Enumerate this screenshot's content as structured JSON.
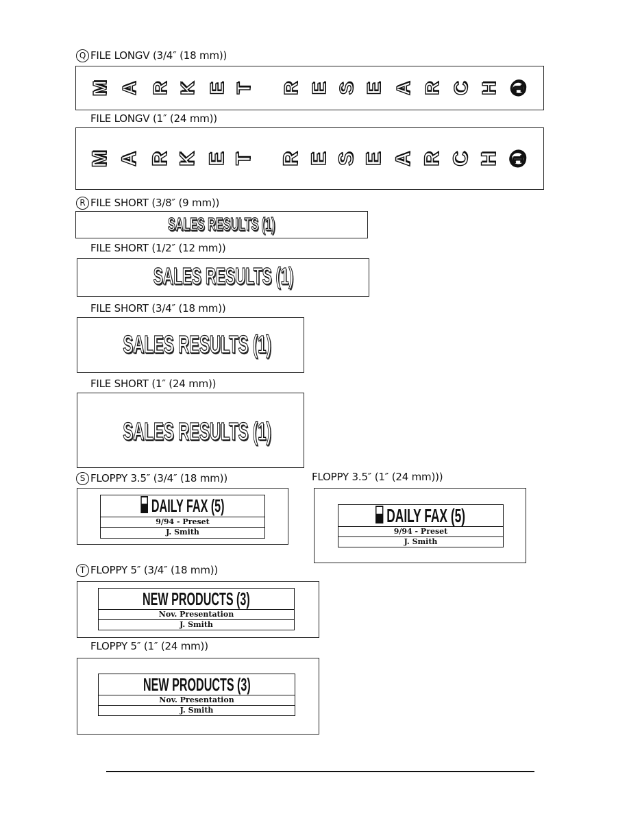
{
  "sections": {
    "q": {
      "marker": "Q",
      "items": [
        {
          "heading": "FILE LONGV (3/4″ (18 mm))",
          "letters": [
            "M",
            "A",
            "R",
            "K",
            "E",
            "T",
            "R",
            "E",
            "S",
            "E",
            "A",
            "R",
            "C",
            "H",
            "①"
          ]
        },
        {
          "heading": "FILE LONGV (1″ (24 mm))",
          "letters": [
            "M",
            "A",
            "R",
            "K",
            "E",
            "T",
            "R",
            "E",
            "S",
            "E",
            "A",
            "R",
            "C",
            "H",
            "①"
          ]
        }
      ]
    },
    "r": {
      "marker": "R",
      "label_text": "SALES RESULTS (1)",
      "items": [
        {
          "heading": "FILE SHORT (3/8″ (9 mm))"
        },
        {
          "heading": "FILE SHORT (1/2″ (12 mm))"
        },
        {
          "heading": "FILE SHORT (3/4″ (18 mm))"
        },
        {
          "heading": "FILE SHORT (1″ (24 mm))"
        }
      ]
    },
    "s": {
      "marker": "S",
      "items": [
        {
          "heading": "FLOPPY 3.5″ (3/4″ (18 mm))",
          "title": "DAILY FAX (5)",
          "line1": "9/94 - Preset",
          "line2": "J. Smith",
          "icon": "floppy-disk-icon"
        },
        {
          "heading": "FLOPPY 3.5″ (1″ (24 mm)))",
          "title": "DAILY FAX (5)",
          "line1": "9/94 - Preset",
          "line2": "J. Smith",
          "icon": "floppy-disk-icon"
        }
      ]
    },
    "t": {
      "marker": "T",
      "items": [
        {
          "heading": "FLOPPY 5″ (3/4″ (18 mm))",
          "title": "NEW PRODUCTS (3)",
          "line1": "Nov. Presentation",
          "line2": "J. Smith"
        },
        {
          "heading": "FLOPPY 5″ (1″ (24 mm))",
          "title": "NEW PRODUCTS (3)",
          "line1": "Nov. Presentation",
          "line2": "J. Smith"
        }
      ]
    }
  }
}
